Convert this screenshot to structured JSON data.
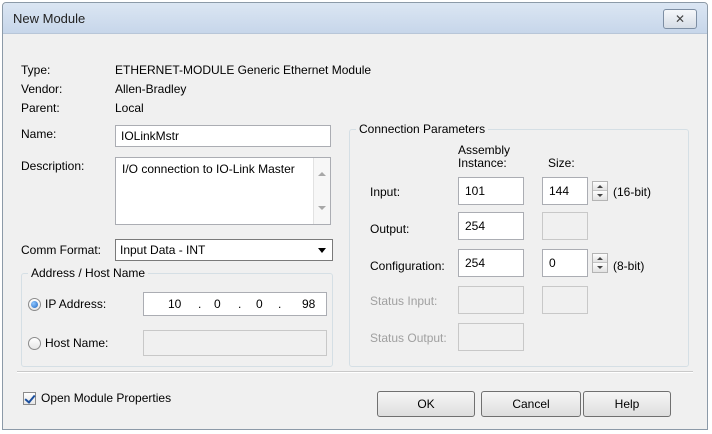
{
  "window": {
    "title": "New Module",
    "close_glyph": "✕"
  },
  "info": {
    "type_label": "Type:",
    "type_value": "ETHERNET-MODULE Generic Ethernet Module",
    "vendor_label": "Vendor:",
    "vendor_value": "Allen-Bradley",
    "parent_label": "Parent:",
    "parent_value": "Local"
  },
  "name": {
    "label": "Name:",
    "value": "IOLinkMstr"
  },
  "description": {
    "label": "Description:",
    "value": "I/O connection to IO-Link Master"
  },
  "comm_format": {
    "label": "Comm Format:",
    "value": "Input Data - INT"
  },
  "address": {
    "group_title": "Address / Host Name",
    "ip_label": "IP Address:",
    "ip_selected": true,
    "ip_octets": [
      "10",
      "0",
      "0",
      "98"
    ],
    "ip_separator": ".",
    "host_label": "Host Name:",
    "host_selected": false,
    "host_value": ""
  },
  "connection": {
    "group_title": "Connection Parameters",
    "assembly_header_line1": "Assembly",
    "assembly_header_line2": "Instance:",
    "size_header": "Size:",
    "rows": [
      {
        "label": "Input:",
        "instance": "101",
        "size": "144",
        "unit": "(16-bit)",
        "enabled": true
      },
      {
        "label": "Output:",
        "instance": "254",
        "size": "",
        "unit": "",
        "enabled": true
      },
      {
        "label": "Configuration:",
        "instance": "254",
        "size": "0",
        "unit": "(8-bit)",
        "enabled": true
      },
      {
        "label": "Status Input:",
        "instance": "",
        "size": "",
        "unit": "",
        "enabled": false
      },
      {
        "label": "Status Output:",
        "instance": "",
        "size": "",
        "unit": "",
        "enabled": false
      }
    ]
  },
  "footer": {
    "open_props_label": "Open Module Properties",
    "open_props_checked": true,
    "ok_label": "OK",
    "cancel_label": "Cancel",
    "help_label": "Help"
  },
  "icons": {
    "close": "close-icon",
    "dropdown": "chevron-down-icon",
    "spin_up": "spin-up-icon",
    "spin_down": "spin-down-icon",
    "checkmark": "checkmark-icon"
  }
}
